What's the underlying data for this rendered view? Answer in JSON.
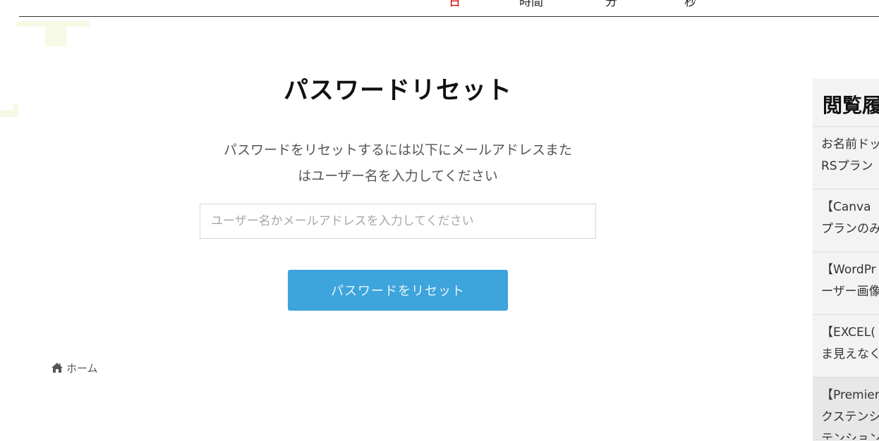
{
  "countdown": {
    "units": [
      "日",
      "時間",
      "分",
      "秒"
    ]
  },
  "form": {
    "title": "パスワードリセット",
    "description_lines": [
      "パスワードをリセットするには以下にメールアドレスまた",
      "はユーザー名を入力してください"
    ],
    "input_placeholder": "ユーザー名かメールアドレスを入力してください",
    "input_value": "",
    "submit_label": "パスワードをリセット"
  },
  "breadcrumb": {
    "home_label": "ホーム",
    "icon": "home-icon"
  },
  "sidebar": {
    "heading": "閲覧履",
    "items": [
      {
        "line1": "お名前ドッ",
        "line2": "RSプラン"
      },
      {
        "line1": "【Canva",
        "line2": "プランのみ"
      },
      {
        "line1": "【WordPr",
        "line2": "ーザー画像"
      },
      {
        "line1": "【EXCEL(",
        "line2": "ま見えなく"
      },
      {
        "line1": "【Premier",
        "line2": "クステンシ",
        "line3": "テンション"
      }
    ]
  },
  "colors": {
    "button": "#3ea4dc",
    "countdown_day": "#d40000",
    "deco": "#f6f9e6"
  }
}
